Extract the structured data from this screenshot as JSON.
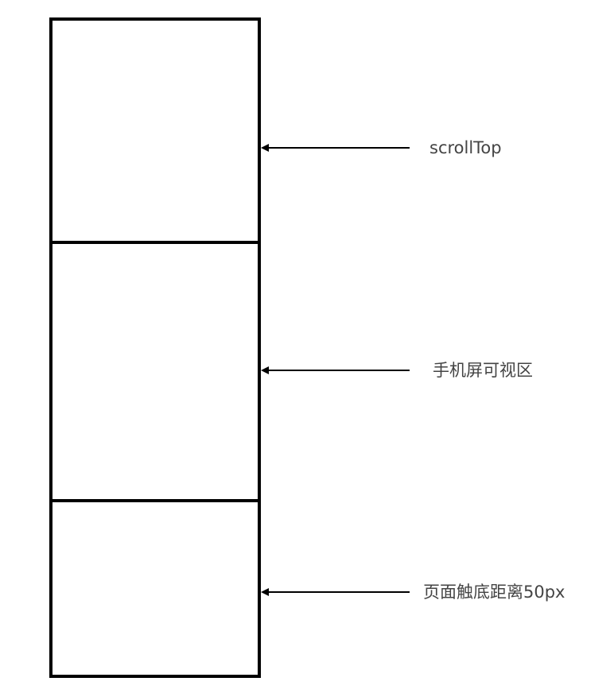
{
  "labels": {
    "scroll_top": "scrollTop",
    "viewport": "手机屏可视区",
    "bottom_distance": "页面触底距离50px"
  },
  "colors": {
    "stroke": "#000000",
    "text": "#444444",
    "background": "#ffffff"
  }
}
